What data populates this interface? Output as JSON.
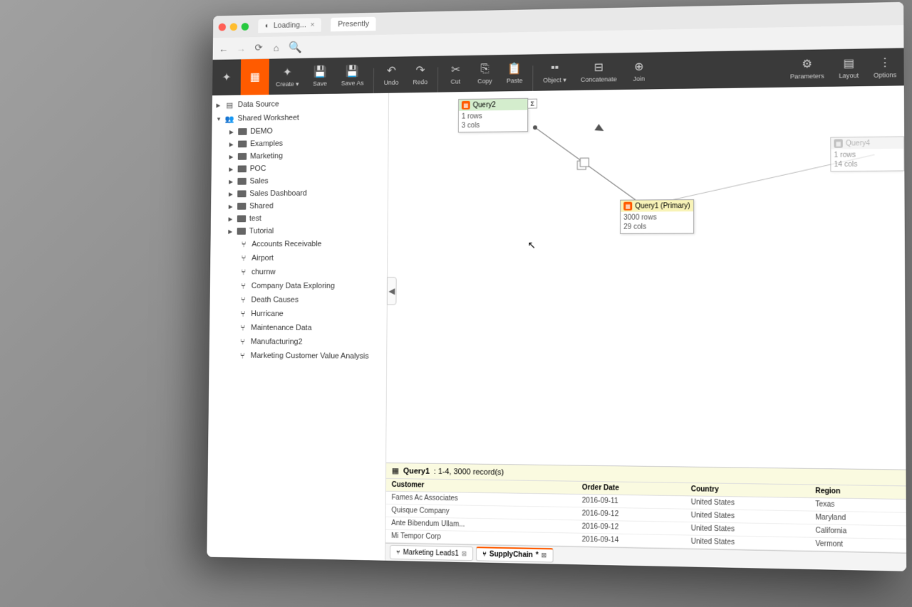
{
  "browser": {
    "tabs": [
      {
        "label": "Loading...",
        "loading": true
      },
      {
        "label": "Presently"
      }
    ]
  },
  "toolbar": {
    "create": "Create",
    "save": "Save",
    "save_as": "Save As",
    "undo": "Undo",
    "redo": "Redo",
    "cut": "Cut",
    "copy": "Copy",
    "paste": "Paste",
    "object": "Object",
    "concatenate": "Concatenate",
    "join": "Join",
    "parameters": "Parameters",
    "layout": "Layout",
    "options": "Options"
  },
  "sidebar": {
    "roots": [
      {
        "icon": "datasource",
        "label": "Data Source"
      },
      {
        "icon": "shared",
        "label": "Shared Worksheet"
      }
    ],
    "folders": [
      "DEMO",
      "Examples",
      "Marketing",
      "POC",
      "Sales",
      "Sales Dashboard",
      "Shared",
      "test",
      "Tutorial"
    ],
    "worksheets": [
      "Accounts Receivable",
      "Airport",
      "churnw",
      "Company Data Exploring",
      "Death Causes",
      "Hurricane",
      "Maintenance Data",
      "Manufacturing2",
      "Marketing Customer Value Analysis"
    ]
  },
  "canvas": {
    "nodes": {
      "query2": {
        "label": "Query2",
        "rows": "1 rows",
        "cols": "3 cols"
      },
      "query1": {
        "label": "Query1 (Primary)",
        "rows": "3000 rows",
        "cols": "29 cols"
      },
      "query4": {
        "label": "Query4",
        "rows": "1 rows",
        "cols": "14 cols"
      }
    }
  },
  "data_panel": {
    "title_name": "Query1",
    "title_range": ": 1-4, 3000 record(s)",
    "columns": [
      "Customer",
      "Order Date",
      "Country",
      "Region"
    ],
    "rows": [
      [
        "Fames Ac Associates",
        "2016-09-11",
        "United States",
        "Texas"
      ],
      [
        "Quisque Company",
        "2016-09-12",
        "United States",
        "Maryland"
      ],
      [
        "Ante Bibendum Ullam...",
        "2016-09-12",
        "United States",
        "California"
      ],
      [
        "Mi Tempor Corp",
        "2016-09-14",
        "United States",
        "Vermont"
      ]
    ]
  },
  "bottom_tabs": [
    {
      "label": "Marketing Leads1"
    },
    {
      "label": "SupplyChain",
      "active": true
    }
  ]
}
